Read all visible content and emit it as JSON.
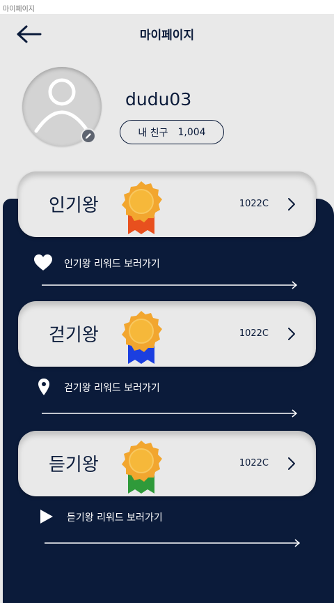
{
  "window": {
    "tab_title": "마이페이지"
  },
  "header": {
    "title": "마이페이지",
    "back_icon": "arrow-left-icon"
  },
  "profile": {
    "username": "dudu03",
    "friends_label": "내 친구",
    "friends_count": "1,004",
    "avatar_icon": "user-silhouette-icon",
    "edit_icon": "pencil-icon"
  },
  "categories": [
    {
      "title": "인기왕",
      "points": "1022C",
      "ribbon_color": "#e8501e",
      "reward_label": "인기왕 리워드 보러가기",
      "reward_icon": "heart-icon"
    },
    {
      "title": "걷기왕",
      "points": "1022C",
      "ribbon_color": "#1b3fe0",
      "reward_label": "걷기왕 리워드 보러가기",
      "reward_icon": "location-pin-icon"
    },
    {
      "title": "듣기왕",
      "points": "1022C",
      "ribbon_color": "#2f9a3a",
      "reward_label": "듣기왕 리워드 보러가기",
      "reward_icon": "play-icon"
    }
  ],
  "colors": {
    "navy": "#0b1b3a",
    "background": "#e9e9e9",
    "medal_gold": "#f2a62f"
  }
}
